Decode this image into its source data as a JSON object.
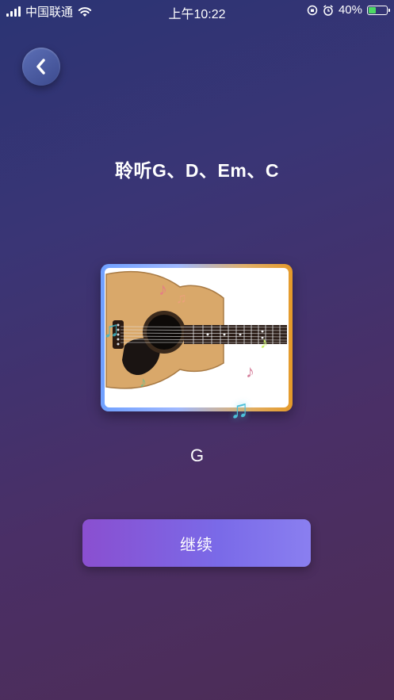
{
  "status_bar": {
    "carrier": "中国联通",
    "time": "上午10:22",
    "battery_percent": "40%"
  },
  "page": {
    "title": "聆听G、D、Em、C",
    "chord": "G",
    "continue_label": "继续"
  },
  "colors": {
    "accent": "#7a6ae8",
    "background_start": "#2b3474",
    "background_end": "#4d2c55"
  },
  "icons": {
    "back": "chevron-left-icon",
    "music": "music-note-icon"
  }
}
